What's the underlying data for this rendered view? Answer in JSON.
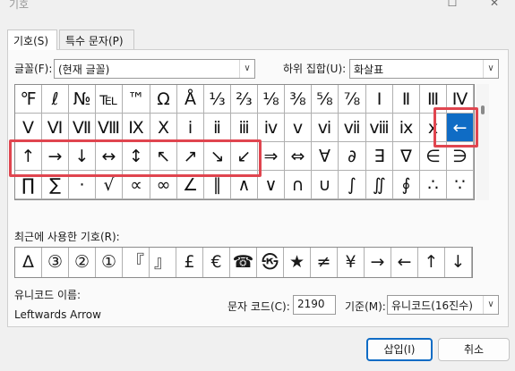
{
  "window": {
    "title": "기호",
    "maximize_icon": "maximize-icon",
    "close_icon": "close-icon"
  },
  "tabs": [
    {
      "label": "기호(S)",
      "active": true
    },
    {
      "label": "특수 문자(P)",
      "active": false
    }
  ],
  "font": {
    "label": "글꼴(F):",
    "value": "(현재 글꼴)"
  },
  "subset": {
    "label": "하위 집합(U):",
    "value": "화살표"
  },
  "symbol_grid": {
    "rows": [
      [
        "℉",
        "ℓ",
        "№",
        "℡",
        "™",
        "Ω",
        "Å",
        "⅓",
        "⅔",
        "⅛",
        "⅜",
        "⅝",
        "⅞",
        "Ⅰ",
        "Ⅱ",
        "Ⅲ",
        "Ⅳ"
      ],
      [
        "Ⅴ",
        "Ⅵ",
        "Ⅶ",
        "Ⅷ",
        "Ⅸ",
        "Ⅹ",
        "ⅰ",
        "ⅱ",
        "ⅲ",
        "ⅳ",
        "ⅴ",
        "ⅵ",
        "ⅶ",
        "ⅷ",
        "ⅸ",
        "ⅹ",
        "←"
      ],
      [
        "↑",
        "→",
        "↓",
        "↔",
        "↕",
        "↖",
        "↗",
        "↘",
        "↙",
        "⇒",
        "⇔",
        "∀",
        "∂",
        "∃",
        "∇",
        "∈",
        "∋"
      ],
      [
        "∏",
        "∑",
        "·",
        "√",
        "∝",
        "∞",
        "∠",
        "∥",
        "∧",
        "∨",
        "∩",
        "∪",
        "∫",
        "∬",
        "∮",
        "∴",
        "∵"
      ]
    ],
    "selected": "←"
  },
  "recent": {
    "label": "최근에 사용한 기호(R):",
    "symbols": [
      "Δ",
      "③",
      "②",
      "①",
      "『",
      "』",
      "£",
      "€",
      "☎",
      "㉿",
      "★",
      "≠",
      "¥",
      "→",
      "←",
      "↑",
      "↓"
    ]
  },
  "unicode_name": {
    "label": "유니코드 이름:",
    "value": "Leftwards Arrow"
  },
  "char_code": {
    "label": "문자 코드(C):",
    "value": "2190"
  },
  "base": {
    "label": "기준(M):",
    "value": "유니코드(16진수)"
  },
  "buttons": {
    "insert": "삽입(I)",
    "cancel": "취소"
  }
}
